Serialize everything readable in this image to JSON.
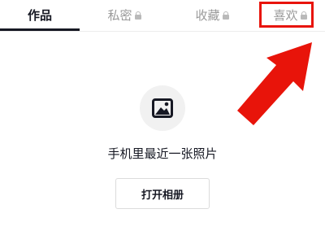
{
  "tabs": [
    {
      "label": "作品",
      "locked": false,
      "active": true
    },
    {
      "label": "私密",
      "locked": true,
      "active": false
    },
    {
      "label": "收藏",
      "locked": true,
      "active": false
    },
    {
      "label": "喜欢",
      "locked": true,
      "active": false
    }
  ],
  "empty_state": {
    "icon": "image-icon",
    "message": "手机里最近一张照片",
    "button_label": "打开相册"
  },
  "annotation": {
    "color": "#e8140a",
    "target": "tab-liked"
  },
  "colors": {
    "active_text": "#161823",
    "inactive_text": "#9a9a9a"
  }
}
